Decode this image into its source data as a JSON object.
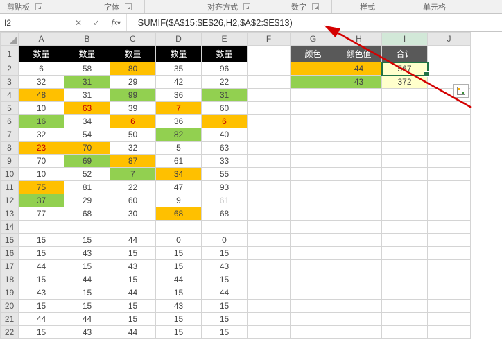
{
  "ribbon": {
    "groups": [
      "剪贴板",
      "字体",
      "对齐方式",
      "数字",
      "样式",
      "单元格"
    ]
  },
  "namebox": "I2",
  "formula": "=SUMIF($A$15:$E$26,H2,$A$2:$E$13)",
  "columns": [
    "A",
    "B",
    "C",
    "D",
    "E",
    "F",
    "G",
    "H",
    "I",
    "J"
  ],
  "headers_row1": {
    "A": "数量",
    "B": "数量",
    "C": "数量",
    "D": "数量",
    "E": "数量",
    "G": "颜色",
    "H": "颜色值",
    "I": "合计"
  },
  "data": {
    "2": {
      "A": {
        "v": "6"
      },
      "B": {
        "v": "58"
      },
      "C": {
        "v": "80",
        "c": "orange"
      },
      "D": {
        "v": "35"
      },
      "E": {
        "v": "96"
      },
      "G": {
        "v": "",
        "c": "orange"
      },
      "H": {
        "v": "44",
        "c": "orange"
      },
      "I": {
        "v": "567",
        "c": "yellowish"
      }
    },
    "3": {
      "A": {
        "v": "32"
      },
      "B": {
        "v": "31",
        "c": "green"
      },
      "C": {
        "v": "29"
      },
      "D": {
        "v": "42"
      },
      "E": {
        "v": "22"
      },
      "G": {
        "v": "",
        "c": "green"
      },
      "H": {
        "v": "43",
        "c": "green"
      },
      "I": {
        "v": "372",
        "c": "yellowish"
      }
    },
    "4": {
      "A": {
        "v": "48",
        "c": "orange"
      },
      "B": {
        "v": "31"
      },
      "C": {
        "v": "99",
        "c": "green"
      },
      "D": {
        "v": "36"
      },
      "E": {
        "v": "31",
        "c": "green"
      }
    },
    "5": {
      "A": {
        "v": "10"
      },
      "B": {
        "v": "63",
        "c": "orange-red"
      },
      "C": {
        "v": "39"
      },
      "D": {
        "v": "7",
        "c": "orange-red"
      },
      "E": {
        "v": "60"
      }
    },
    "6": {
      "A": {
        "v": "16",
        "c": "green"
      },
      "B": {
        "v": "34"
      },
      "C": {
        "v": "6",
        "c": "orange-red"
      },
      "D": {
        "v": "36"
      },
      "E": {
        "v": "6",
        "c": "orange-red"
      }
    },
    "7": {
      "A": {
        "v": "32"
      },
      "B": {
        "v": "54"
      },
      "C": {
        "v": "50"
      },
      "D": {
        "v": "82",
        "c": "green"
      },
      "E": {
        "v": "40"
      }
    },
    "8": {
      "A": {
        "v": "23",
        "c": "orange-red"
      },
      "B": {
        "v": "70",
        "c": "orange"
      },
      "C": {
        "v": "32"
      },
      "D": {
        "v": "5"
      },
      "E": {
        "v": "63"
      }
    },
    "9": {
      "A": {
        "v": "70"
      },
      "B": {
        "v": "69",
        "c": "green"
      },
      "C": {
        "v": "87",
        "c": "orange"
      },
      "D": {
        "v": "61"
      },
      "E": {
        "v": "33"
      }
    },
    "10": {
      "A": {
        "v": "10"
      },
      "B": {
        "v": "52"
      },
      "C": {
        "v": "7",
        "c": "green"
      },
      "D": {
        "v": "34",
        "c": "orange"
      },
      "E": {
        "v": "55"
      }
    },
    "11": {
      "A": {
        "v": "75",
        "c": "orange"
      },
      "B": {
        "v": "81"
      },
      "C": {
        "v": "22"
      },
      "D": {
        "v": "47"
      },
      "E": {
        "v": "93"
      }
    },
    "12": {
      "A": {
        "v": "37",
        "c": "green"
      },
      "B": {
        "v": "29"
      },
      "C": {
        "v": "60"
      },
      "D": {
        "v": "9"
      },
      "E": {
        "v": "61",
        "c": "faint"
      }
    },
    "13": {
      "A": {
        "v": "77"
      },
      "B": {
        "v": "68"
      },
      "C": {
        "v": "30"
      },
      "D": {
        "v": "68",
        "c": "orange"
      },
      "E": {
        "v": "68"
      }
    },
    "14": {
      "A": {
        "v": ""
      },
      "B": {
        "v": ""
      },
      "C": {
        "v": ""
      },
      "D": {
        "v": ""
      },
      "E": {
        "v": ""
      }
    },
    "15": {
      "A": {
        "v": "15"
      },
      "B": {
        "v": "15"
      },
      "C": {
        "v": "44"
      },
      "D": {
        "v": "0"
      },
      "E": {
        "v": "0"
      }
    },
    "16": {
      "A": {
        "v": "15"
      },
      "B": {
        "v": "43"
      },
      "C": {
        "v": "15"
      },
      "D": {
        "v": "15"
      },
      "E": {
        "v": "15"
      }
    },
    "17": {
      "A": {
        "v": "44"
      },
      "B": {
        "v": "15"
      },
      "C": {
        "v": "43"
      },
      "D": {
        "v": "15"
      },
      "E": {
        "v": "43"
      }
    },
    "18": {
      "A": {
        "v": "15"
      },
      "B": {
        "v": "44"
      },
      "C": {
        "v": "15"
      },
      "D": {
        "v": "44"
      },
      "E": {
        "v": "15"
      }
    },
    "19": {
      "A": {
        "v": "43"
      },
      "B": {
        "v": "15"
      },
      "C": {
        "v": "44"
      },
      "D": {
        "v": "15"
      },
      "E": {
        "v": "44"
      }
    },
    "20": {
      "A": {
        "v": "15"
      },
      "B": {
        "v": "15"
      },
      "C": {
        "v": "15"
      },
      "D": {
        "v": "43"
      },
      "E": {
        "v": "15"
      }
    },
    "21": {
      "A": {
        "v": "44"
      },
      "B": {
        "v": "44"
      },
      "C": {
        "v": "15"
      },
      "D": {
        "v": "15"
      },
      "E": {
        "v": "15"
      }
    },
    "22": {
      "A": {
        "v": "15"
      },
      "B": {
        "v": "43"
      },
      "C": {
        "v": "44"
      },
      "D": {
        "v": "15"
      },
      "E": {
        "v": "15"
      }
    }
  },
  "chart_data": {
    "type": "table",
    "title": "SUMIF color aggregation",
    "columns": [
      "颜色值",
      "合计"
    ],
    "rows": [
      {
        "颜色值": 44,
        "合计": 567
      },
      {
        "颜色值": 43,
        "合计": 372
      }
    ]
  }
}
